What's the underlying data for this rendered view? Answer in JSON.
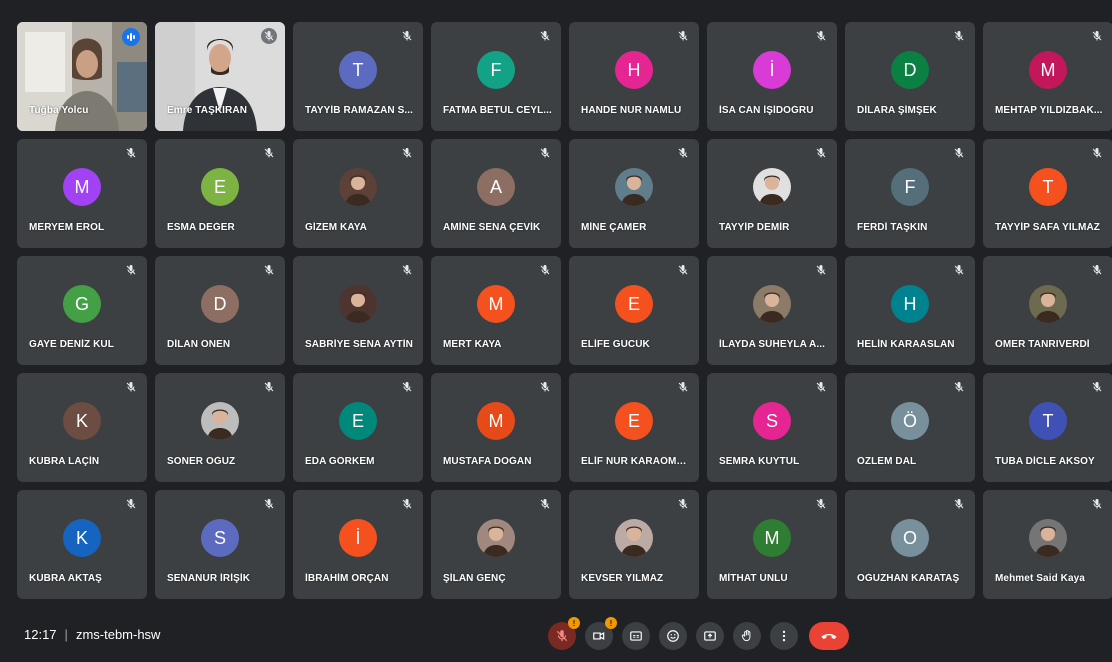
{
  "participants": [
    {
      "name": "Tuğba Yolcu",
      "initial": "",
      "color": "",
      "type": "video1",
      "speaking": true
    },
    {
      "name": "Emre TAŞKIRAN",
      "initial": "",
      "color": "",
      "type": "video2",
      "speaking": false
    },
    {
      "name": "TAYYİB RAMAZAN S...",
      "initial": "T",
      "color": "#5c6bc0",
      "type": "initial"
    },
    {
      "name": "FATMA BETÜL CEYL...",
      "initial": "F",
      "color": "#12a386",
      "type": "initial"
    },
    {
      "name": "HANDE NUR NAMLU",
      "initial": "H",
      "color": "#e52592",
      "type": "initial"
    },
    {
      "name": "İSA CAN İŞİDOĞRU",
      "initial": "İ",
      "color": "#d93bd6",
      "type": "initial"
    },
    {
      "name": "DİLARA ŞİMŞEK",
      "initial": "D",
      "color": "#0b8043",
      "type": "initial"
    },
    {
      "name": "MEHTAP YILDIZBAK...",
      "initial": "M",
      "color": "#c2185b",
      "type": "initial"
    },
    {
      "name": "MERYEM EROL",
      "initial": "M",
      "color": "#a142f4",
      "type": "initial"
    },
    {
      "name": "ESMA DEĞER",
      "initial": "E",
      "color": "#7cb342",
      "type": "initial"
    },
    {
      "name": "GİZEM KAYA",
      "initial": "",
      "color": "#5d4037",
      "type": "photo"
    },
    {
      "name": "AMİNE SENA ÇEVİK",
      "initial": "A",
      "color": "#8d6e63",
      "type": "initial"
    },
    {
      "name": "MİNE ÇAMER",
      "initial": "",
      "color": "#607d8b",
      "type": "photo"
    },
    {
      "name": "TAYYİP DEMİR",
      "initial": "",
      "color": "#e0e0e0",
      "type": "photo"
    },
    {
      "name": "FERDİ TAŞKIN",
      "initial": "F",
      "color": "#546e7a",
      "type": "initial"
    },
    {
      "name": "TAYYİP SAFA YILMAZ",
      "initial": "T",
      "color": "#f4511e",
      "type": "initial"
    },
    {
      "name": "GAYE DENİZ KUL",
      "initial": "G",
      "color": "#43a047",
      "type": "initial"
    },
    {
      "name": "DİLAN ÖNEN",
      "initial": "D",
      "color": "#8d6e63",
      "type": "initial"
    },
    {
      "name": "SABRİYE SENA AYTİN",
      "initial": "",
      "color": "#4e342e",
      "type": "photo"
    },
    {
      "name": "MERT KAYA",
      "initial": "M",
      "color": "#f4511e",
      "type": "initial"
    },
    {
      "name": "ELİFE GÜCÜK",
      "initial": "E",
      "color": "#f4511e",
      "type": "initial"
    },
    {
      "name": "İLAYDA SÜHEYLA A...",
      "initial": "",
      "color": "#8d7b6a",
      "type": "photo"
    },
    {
      "name": "HELİN KARAASLAN",
      "initial": "H",
      "color": "#00838f",
      "type": "initial"
    },
    {
      "name": "ÖMER TANRIVERDİ",
      "initial": "",
      "color": "#6d6a50",
      "type": "photo"
    },
    {
      "name": "KÜBRA LAÇİN",
      "initial": "K",
      "color": "#6d4c41",
      "type": "initial"
    },
    {
      "name": "SONER OĞUZ",
      "initial": "",
      "color": "#bdbdbd",
      "type": "photo"
    },
    {
      "name": "EDA GÖRKEM",
      "initial": "E",
      "color": "#00897b",
      "type": "initial"
    },
    {
      "name": "MUSTAFA DOĞAN",
      "initial": "M",
      "color": "#e64a19",
      "type": "initial"
    },
    {
      "name": "ELİF NUR KARAÖME...",
      "initial": "E",
      "color": "#f4511e",
      "type": "initial"
    },
    {
      "name": "SEMRA KUYTUL",
      "initial": "S",
      "color": "#e52592",
      "type": "initial"
    },
    {
      "name": "ÖZLEM DAL",
      "initial": "Ö",
      "color": "#78909c",
      "type": "initial"
    },
    {
      "name": "TUBA DİCLE AKSOY",
      "initial": "T",
      "color": "#3f51b5",
      "type": "initial"
    },
    {
      "name": "KÜBRA AKTAŞ",
      "initial": "K",
      "color": "#1565c0",
      "type": "initial"
    },
    {
      "name": "SENANUR İRİŞİK",
      "initial": "S",
      "color": "#5c6bc0",
      "type": "initial"
    },
    {
      "name": "İBRAHİM ORÇAN",
      "initial": "İ",
      "color": "#f4511e",
      "type": "initial"
    },
    {
      "name": "ŞİLAN GENÇ",
      "initial": "",
      "color": "#a1887f",
      "type": "photo"
    },
    {
      "name": "KEVSER YILMAZ",
      "initial": "",
      "color": "#bcaaa4",
      "type": "photo"
    },
    {
      "name": "MİTHAT ÜNLÜ",
      "initial": "M",
      "color": "#2e7d32",
      "type": "initial"
    },
    {
      "name": "OĞUZHAN KARATAŞ",
      "initial": "O",
      "color": "#78909c",
      "type": "initial"
    },
    {
      "name": "Mehmet Said Kaya",
      "initial": "",
      "color": "#757575",
      "type": "photo"
    }
  ],
  "bottom": {
    "time": "12:17",
    "separator": "|",
    "meeting_code": "zms-tebm-hsw",
    "warn_badge": "!"
  }
}
